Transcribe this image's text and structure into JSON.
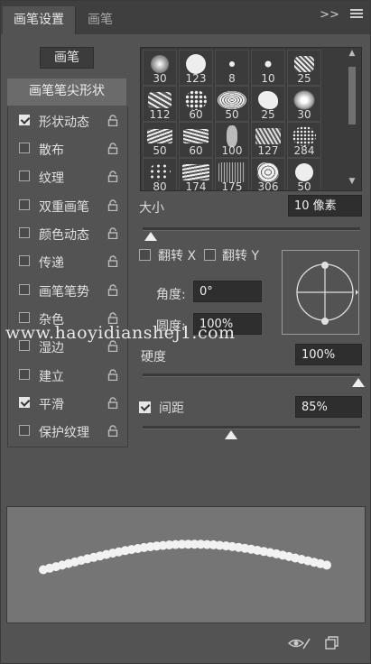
{
  "tabs": [
    {
      "label": "画笔设置",
      "active": true
    },
    {
      "label": "画笔",
      "active": false
    }
  ],
  "tab_tools": {
    "expand_label": ">>",
    "menu_icon": "hamburger-menu-icon"
  },
  "left": {
    "brush_button": "画笔",
    "tip_shape_button": "画笔笔尖形状",
    "options": [
      {
        "label": "形状动态",
        "checked": true
      },
      {
        "label": "散布",
        "checked": false
      },
      {
        "label": "纹理",
        "checked": false
      },
      {
        "label": "双重画笔",
        "checked": false
      },
      {
        "label": "颜色动态",
        "checked": false
      },
      {
        "label": "传递",
        "checked": false
      },
      {
        "label": "画笔笔势",
        "checked": false
      },
      {
        "label": "杂色",
        "checked": false
      },
      {
        "label": "湿边",
        "checked": false
      },
      {
        "label": "建立",
        "checked": false
      },
      {
        "label": "平滑",
        "checked": true
      },
      {
        "label": "保护纹理",
        "checked": false
      }
    ]
  },
  "brushes": [
    {
      "size": "30"
    },
    {
      "size": "123"
    },
    {
      "size": "8"
    },
    {
      "size": "10"
    },
    {
      "size": "25"
    },
    {
      "size": "112"
    },
    {
      "size": "60"
    },
    {
      "size": "50"
    },
    {
      "size": "25"
    },
    {
      "size": "30"
    },
    {
      "size": "50"
    },
    {
      "size": "60"
    },
    {
      "size": "100"
    },
    {
      "size": "127"
    },
    {
      "size": "284"
    },
    {
      "size": "80"
    },
    {
      "size": "174"
    },
    {
      "size": "175"
    },
    {
      "size": "306"
    },
    {
      "size": "50"
    }
  ],
  "size": {
    "label": "大小",
    "value": "10 像素"
  },
  "flip_x": {
    "label": "翻转 X",
    "checked": false
  },
  "flip_y": {
    "label": "翻转 Y",
    "checked": false
  },
  "angle": {
    "label": "角度:",
    "value": "0°"
  },
  "roundness": {
    "label": "圆度:",
    "value": "100%"
  },
  "hardness": {
    "label": "硬度",
    "value": "100%"
  },
  "spacing": {
    "label": "间距",
    "value": "85%",
    "checked": true
  },
  "watermark": "www.haoyidianshej1.com",
  "footer": {
    "left_icon": "eye-brush-icon",
    "right_icon": "new-brush-icon"
  }
}
